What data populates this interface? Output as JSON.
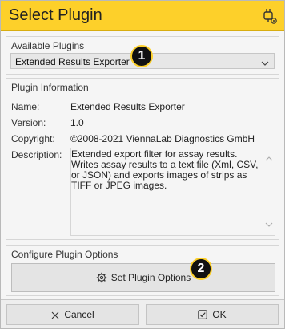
{
  "dialog": {
    "title": "Select Plugin"
  },
  "available": {
    "label": "Available Plugins",
    "selected": "Extended Results Exporter"
  },
  "info": {
    "label": "Plugin Information",
    "name_key": "Name:",
    "name_value": "Extended Results Exporter",
    "version_key": "Version:",
    "version_value": "1.0",
    "copyright_key": "Copyright:",
    "copyright_value": "©2008-2021 ViennaLab Diagnostics GmbH",
    "description_key": "Description:",
    "description_value": "Extended export filter for assay results. Writes assay results to a text file (Xml, CSV, or JSON) and exports images of strips as TIFF or JPEG images."
  },
  "config": {
    "label": "Configure Plugin Options",
    "button_label": "Set Plugin Options"
  },
  "badges": {
    "one": "1",
    "two": "2"
  },
  "footer": {
    "cancel_label": "Cancel",
    "ok_label": "OK"
  },
  "icons": {
    "plugin": "plugin-settings-icon",
    "chevron": "chevron-down-icon",
    "gear": "gear-icon",
    "cancel": "close-icon",
    "ok": "check-box-icon"
  },
  "colors": {
    "accent": "#fdd02a",
    "badge": "#111111"
  }
}
